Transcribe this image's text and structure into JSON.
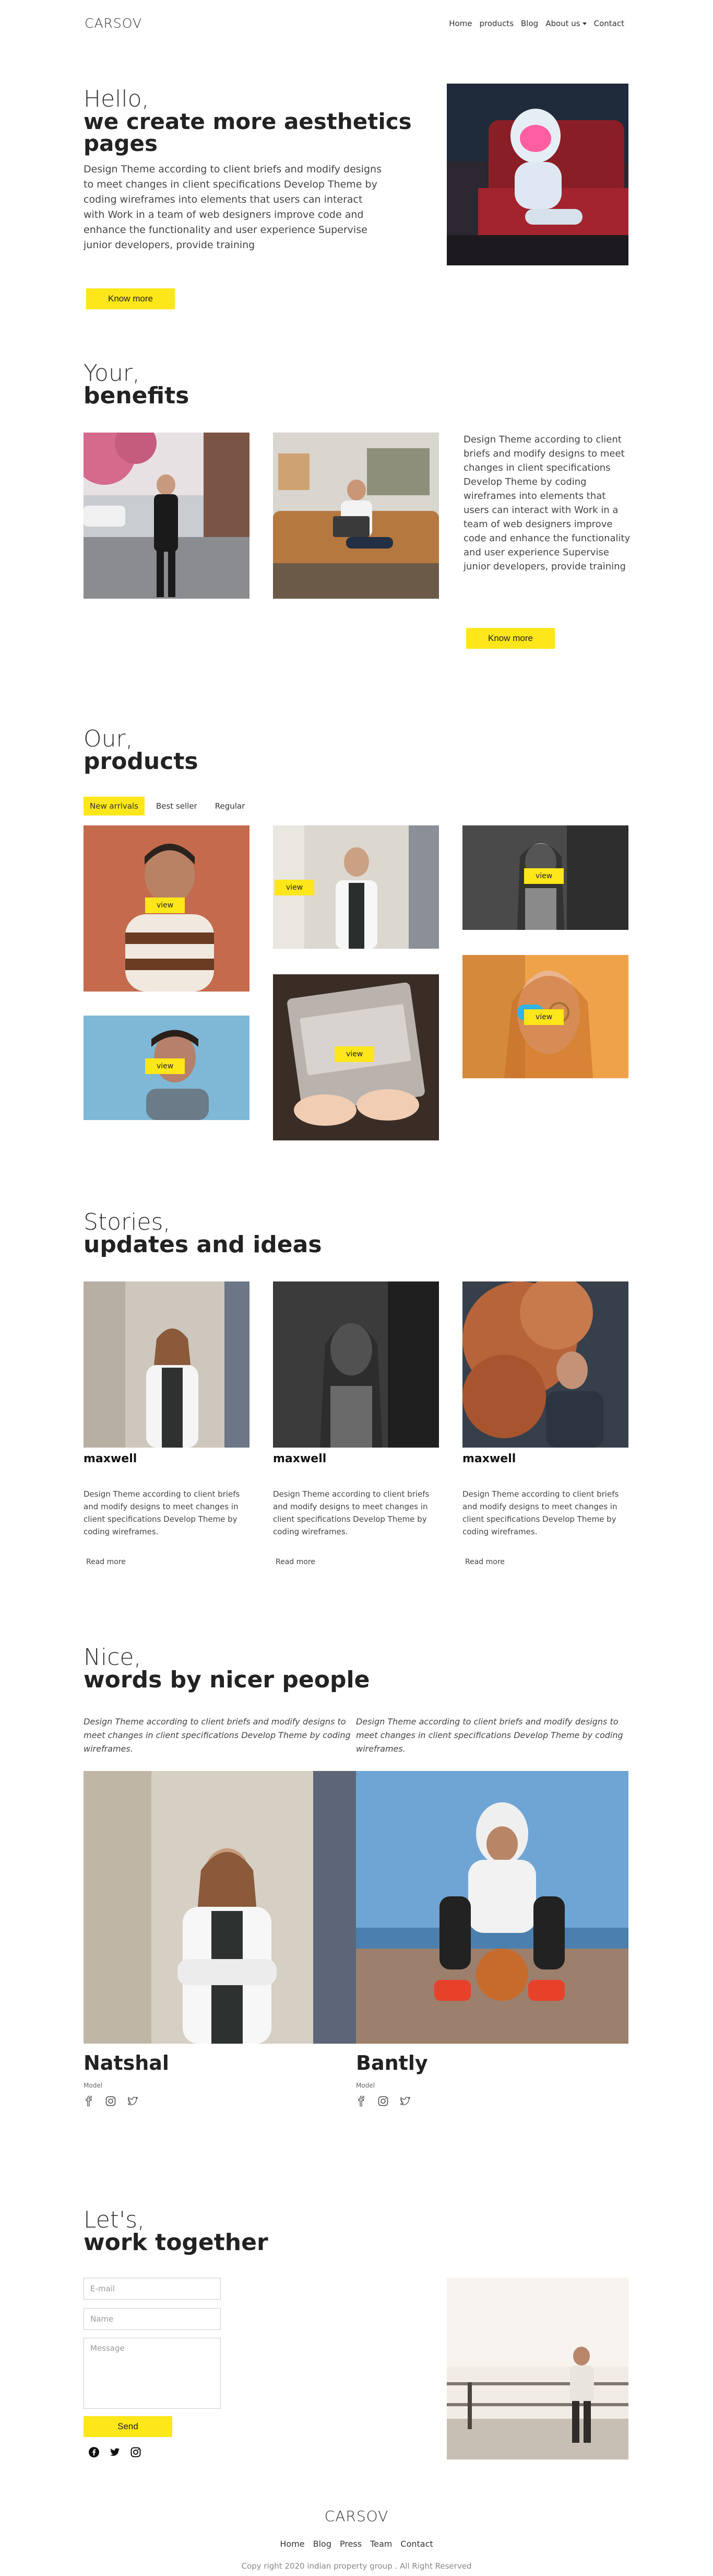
{
  "nav": {
    "logo": "CARSOV",
    "items": [
      "Home",
      "products",
      "Blog",
      "About us",
      "Contact"
    ]
  },
  "hero": {
    "greeting": "Hello,",
    "title_line1": "we create more aesthetics",
    "title_line2": "pages",
    "body": "Design Theme according to client briefs and modify designs to meet changes in client specifications Develop Theme by coding wireframes into elements that users can interact with Work in a team of web designers improve code and enhance the functionality and user experience Supervise junior developers, provide training",
    "button": "Know more"
  },
  "benefits": {
    "heading_light": "Your,",
    "heading_bold": "benefits",
    "body": "Design Theme according to client briefs and modify designs to meet changes in client specifications Develop Theme by coding wireframes into elements that users can interact with Work in a team of web designers improve code and enhance the functionality and user experience Supervise junior developers, provide training",
    "button": "Know more"
  },
  "products": {
    "heading_light": "Our,",
    "heading_bold": "products",
    "tabs": [
      "New arrivals",
      "Best seller",
      "Regular"
    ],
    "view_label": "view"
  },
  "stories": {
    "heading_light": "Stories,",
    "heading_bold": "updates and ideas",
    "items": [
      {
        "name": "maxwell",
        "text": "Design Theme according to client briefs and modify designs to meet changes in client specifications Develop Theme by coding wireframes.",
        "link": "Read more"
      },
      {
        "name": "maxwell",
        "text": "Design Theme according to client briefs and modify designs to meet changes in client specifications Develop Theme by coding wireframes.",
        "link": "Read more"
      },
      {
        "name": "maxwell",
        "text": "Design Theme according to client briefs and modify designs to meet changes in client specifications Develop Theme by coding wireframes.",
        "link": "Read more"
      }
    ]
  },
  "testimonials": {
    "heading_light": "Nice,",
    "heading_bold": "words by nicer people",
    "people": [
      {
        "quote": "Design Theme according to client briefs and modify designs to meet changes in client specifications Develop Theme by coding wireframes.",
        "name": "Natshal",
        "role": "Model"
      },
      {
        "quote": "Design Theme according to client briefs and modify designs to meet changes in client specifications Develop Theme by coding wireframes.",
        "name": "Bantly",
        "role": "Model"
      }
    ]
  },
  "contact": {
    "heading_light": "Let's,",
    "heading_bold": "work together",
    "email_placeholder": "E-mail",
    "name_placeholder": "Name",
    "message_placeholder": "Message",
    "button": "Send"
  },
  "footer": {
    "logo": "CARSOV",
    "items": [
      "Home",
      "Blog",
      "Press",
      "Team",
      "Contact"
    ],
    "copyright": "Copy right 2020 indian property group . All Right Reserved"
  },
  "colors": {
    "accent": "#fde619",
    "text": "#222222"
  },
  "icons": [
    "chevron-down-icon",
    "facebook-icon",
    "instagram-icon",
    "twitter-icon"
  ]
}
